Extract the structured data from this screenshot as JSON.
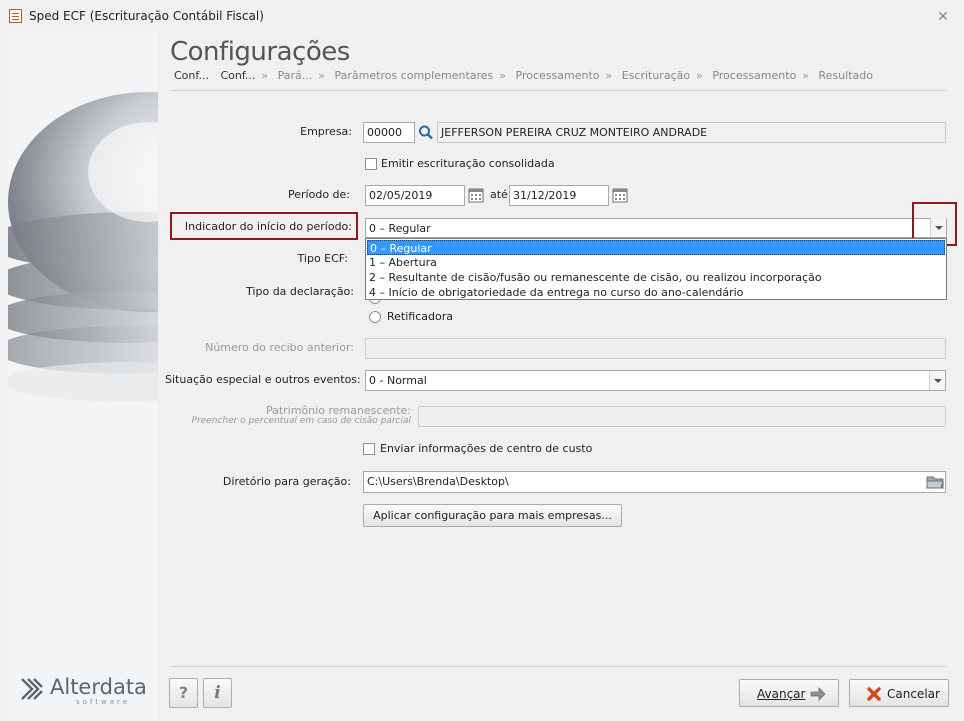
{
  "window": {
    "title": "Sped ECF (Escrituração Contábil Fiscal)"
  },
  "page": {
    "title": "Configurações",
    "breadcrumb": [
      "Conf...",
      "Conf...",
      "Pará...",
      "Parâmetros complementares",
      "Processamento",
      "Escrituração",
      "Processamento",
      "Resultado"
    ],
    "breadcrumb_sep": "»"
  },
  "form": {
    "empresa": {
      "label": "Empresa:",
      "code": "00000",
      "name": "JEFFERSON PEREIRA CRUZ MONTEIRO ANDRADE"
    },
    "consolidada": {
      "label": "Emitir escrituração consolidada",
      "checked": false
    },
    "periodo": {
      "label": "Período de:",
      "from": "02/05/2019",
      "ate_label": "até",
      "to": "31/12/2019"
    },
    "indicador": {
      "label": "Indicador do início do período:",
      "value": "0 – Regular",
      "options": [
        "0 – Regular",
        "1 – Abertura",
        "2 – Resultante de cisão/fusão ou remanescente de cisão, ou realizou incorporação",
        "4 – Início de obrigatoriedade da entrega no curso do ano-calendário"
      ],
      "selected_index": 0
    },
    "tipo_ecf": {
      "label": "Tipo ECF:"
    },
    "tipo_declaracao": {
      "label": "Tipo da declaração:",
      "option_retificadora": "Retificadora"
    },
    "numero_recibo": {
      "label": "Número do recibo anterior:",
      "value": ""
    },
    "situacao": {
      "label": "Situação especial e outros eventos:",
      "value": "0 - Normal"
    },
    "patrimonio": {
      "label": "Patrimônio remanescente:",
      "sublabel": "Preencher o percentual em caso de cisão parcial",
      "value": ""
    },
    "centro_custo": {
      "label": "Enviar informações de centro de custo",
      "checked": false
    },
    "diretorio": {
      "label": "Diretório para geração:",
      "value": "C:\\Users\\Brenda\\Desktop\\"
    },
    "aplicar_button": "Aplicar configuração para mais empresas..."
  },
  "footer": {
    "help_label": "?",
    "info_label": "i",
    "next_label": "Avançar",
    "cancel_label": "Cancelar",
    "logo_text": "Alterdata",
    "logo_sub": "software"
  },
  "colors": {
    "highlight": "#8b1a1a",
    "selection": "#3399ff",
    "logo": "#5a6470"
  }
}
